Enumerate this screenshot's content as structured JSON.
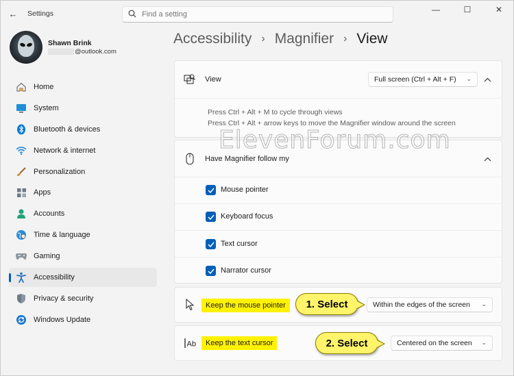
{
  "app": {
    "title": "Settings",
    "back_glyph": "←"
  },
  "search": {
    "placeholder": "Find a setting"
  },
  "window_controls": {
    "minimize": "—",
    "maximize": "☐",
    "close": "✕"
  },
  "user": {
    "name": "Shawn Brink",
    "email": "@outlook.com"
  },
  "sidebar": {
    "items": [
      {
        "label": "Home",
        "icon": "home-icon"
      },
      {
        "label": "System",
        "icon": "system-icon"
      },
      {
        "label": "Bluetooth & devices",
        "icon": "bluetooth-icon"
      },
      {
        "label": "Network & internet",
        "icon": "wifi-icon"
      },
      {
        "label": "Personalization",
        "icon": "brush-icon"
      },
      {
        "label": "Apps",
        "icon": "apps-icon"
      },
      {
        "label": "Accounts",
        "icon": "account-icon"
      },
      {
        "label": "Time & language",
        "icon": "globe-icon"
      },
      {
        "label": "Gaming",
        "icon": "gamepad-icon"
      },
      {
        "label": "Accessibility",
        "icon": "accessibility-icon",
        "active": true
      },
      {
        "label": "Privacy & security",
        "icon": "shield-icon"
      },
      {
        "label": "Windows Update",
        "icon": "update-icon"
      }
    ]
  },
  "breadcrumb": {
    "part1": "Accessibility",
    "part2": "Magnifier",
    "current": "View",
    "sep": "›"
  },
  "view_card": {
    "label": "View",
    "dropdown_value": "Full screen (Ctrl + Alt + F)",
    "desc_line1": "Press Ctrl + Alt + M to cycle through views",
    "desc_line2": "Press Ctrl + Alt + arrow keys to move the Magnifier window around the screen"
  },
  "follow_card": {
    "label": "Have Magnifier follow my",
    "options": [
      {
        "label": "Mouse pointer",
        "checked": true
      },
      {
        "label": "Keyboard focus",
        "checked": true
      },
      {
        "label": "Text cursor",
        "checked": true
      },
      {
        "label": "Narrator cursor",
        "checked": true
      }
    ]
  },
  "mouse_card": {
    "label": "Keep the mouse pointer",
    "dropdown_value": "Within the edges of the screen",
    "callout": "1. Select"
  },
  "text_card": {
    "label": "Keep the text cursor",
    "dropdown_value": "Centered on the screen",
    "callout": "2. Select"
  },
  "watermark": "ElevenForum.com",
  "colors": {
    "accent": "#005fb8",
    "highlight": "#fff200",
    "callout": "#fff46a"
  }
}
